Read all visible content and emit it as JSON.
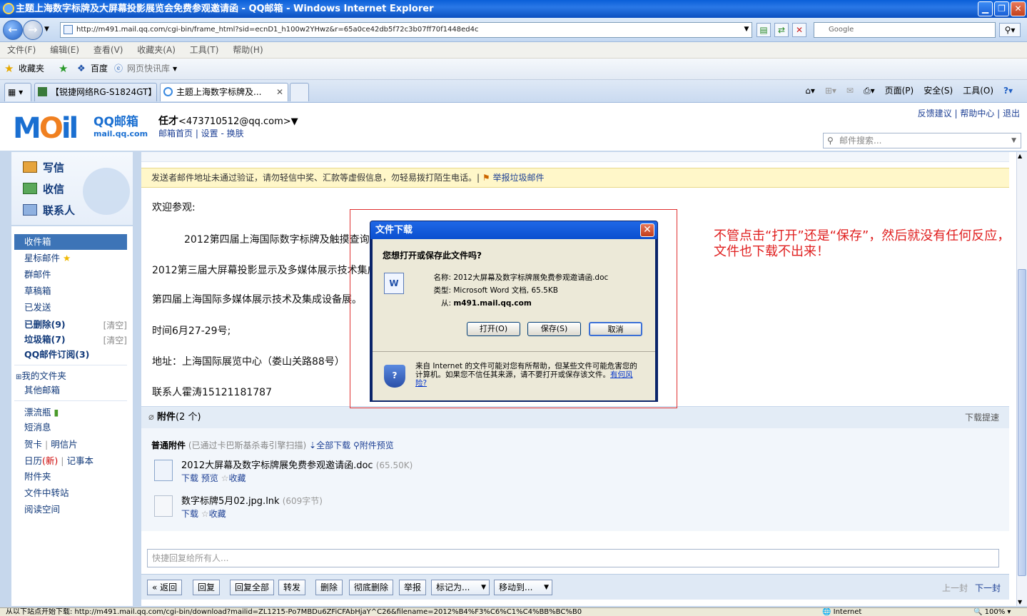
{
  "window": {
    "title": "主题上海数字标牌及大屏幕投影展览会免费参观邀请函 - QQ邮箱 - Windows Internet Explorer"
  },
  "browser": {
    "address": "http://m491.mail.qq.com/cgi-bin/frame_html?sid=ecnD1_h100w2YHwz&r=65a0ce42db5f72c3b07ff70f1448ed4c",
    "search_placeholder": "Google",
    "menu": [
      "文件(F)",
      "编辑(E)",
      "查看(V)",
      "收藏夹(A)",
      "工具(T)",
      "帮助(H)"
    ],
    "favorites": {
      "label": "收藏夹",
      "baidu": "百度",
      "feeds": "网页快讯库"
    },
    "tabs": [
      "【锐捷网络RG-S1824GT】...",
      "主题上海数字标牌及..."
    ],
    "commands": {
      "page": "页面(P)",
      "safety": "安全(S)",
      "tools": "工具(O)"
    }
  },
  "mail": {
    "brand": "QQ邮箱",
    "brand_url": "mail.qq.com",
    "user_name": "任才",
    "user_email": "<473710512@qq.com>",
    "user_links": "邮箱首页 | 设置 - 换肤",
    "top_links": "反馈建议 | 帮助中心 | 退出",
    "search_placeholder": "邮件搜索...",
    "compose": "写信",
    "receive": "收信",
    "contacts": "联系人",
    "folders": {
      "inbox": "收件箱",
      "starred": "星标邮件",
      "group": "群邮件",
      "drafts": "草稿箱",
      "sent": "已发送",
      "deleted": "已删除(9)",
      "spam": "垃圾箱(7)",
      "subscriptions": "QQ邮件订阅(3)",
      "clear": "[清空]",
      "my_folders": "我的文件夹",
      "other_mail": "其他邮箱",
      "bottle": "漂流瓶",
      "sms": "短消息",
      "greeting": "贺卡",
      "postcard": "明信片",
      "calendar": "日历",
      "calendar_new": "(新)",
      "notes": "记事本",
      "attachments": "附件夹",
      "transfer": "文件中转站",
      "reading": "阅读空间"
    },
    "warning": "发送者邮件地址未通过验证，请勿轻信中奖、汇款等虚假信息，勿轻易拨打陌生电话。|",
    "report_spam": "举报垃圾邮件",
    "body": [
      "欢迎参观:",
      "2012第四届上海国际数字标牌及触摸查询",
      "2012第三届大屏幕投影显示及多媒体展示技术集成",
      "第四届上海国际多媒体展示技术及集成设备展。",
      "时间6月27-29号;",
      "地址：上海国际展览中心（娄山关路88号）",
      "联系人霍涛15121181787"
    ],
    "attach": {
      "title": "附件",
      "count": "(2 个)",
      "fast": "下载提速",
      "normal": "普通附件",
      "scanned": "(已通过卡巴斯基杀毒引擎扫描)",
      "download_all": "全部下载",
      "preview_all": "附件预览",
      "files": [
        {
          "name": "2012大屏幕及数字标牌展免费参观邀请函.doc",
          "size": "(65.50K)",
          "download": "下载",
          "preview": "预览",
          "save": "收藏"
        },
        {
          "name": "数字标牌5月02.jpg.lnk",
          "size": "(609字节)",
          "download": "下载",
          "save": "收藏"
        }
      ]
    },
    "reply_placeholder": "快捷回复给所有人...",
    "actions": {
      "back": "« 返回",
      "reply": "回复",
      "reply_all": "回复全部",
      "forward": "转发",
      "delete": "删除",
      "purge": "彻底删除",
      "report": "举报",
      "mark": "标记为...",
      "move": "移动到...",
      "prev": "上一封",
      "next": "下一封"
    }
  },
  "dialog": {
    "title": "文件下载",
    "question": "您想打开或保存此文件吗?",
    "name_label": "名称:",
    "name_value": "2012大屏幕及数字标牌展免费参观邀请函.doc",
    "type_label": "类型:",
    "type_value": "Microsoft Word 文档, 65.5KB",
    "from_label": "从:",
    "from_value": "m491.mail.qq.com",
    "open": "打开(O)",
    "save": "保存(S)",
    "cancel": "取消",
    "info": "来自 Internet 的文件可能对您有所帮助，但某些文件可能危害您的计算机。如果您不信任其来源，请不要打开或保存该文件。",
    "risk_link": "有何风险?"
  },
  "annotation": "不管点击“打开”还是“保存”，然后就没有任何反应，文件也下载不出来！",
  "status": {
    "text": "从以下站点开始下载: http://m491.mail.qq.com/cgi-bin/download?mailid=ZL1215-Po7MBDu6ZFiCFAbHjaY^C26&filename=2012%B4%F3%C6%C1%C4%BB%BC%B0",
    "zone": "Internet",
    "zoom": "100%"
  }
}
